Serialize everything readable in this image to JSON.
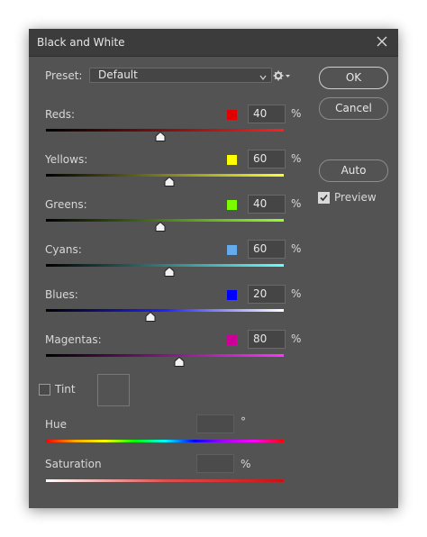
{
  "dialog": {
    "title": "Black and White"
  },
  "preset": {
    "label": "Preset:",
    "value": "Default"
  },
  "buttons": {
    "ok": "OK",
    "cancel": "Cancel",
    "auto": "Auto"
  },
  "preview": {
    "label": "Preview",
    "checked": true
  },
  "sliders": [
    {
      "label": "Reds:",
      "value": "40",
      "pos": 0.48,
      "color": "#e00000",
      "grad": "linear-gradient(to right,#000000,#ff2020)"
    },
    {
      "label": "Yellows:",
      "value": "60",
      "pos": 0.52,
      "color": "#ffff00",
      "grad": "linear-gradient(to right,#000000,#ffff33)"
    },
    {
      "label": "Greens:",
      "value": "40",
      "pos": 0.48,
      "color": "#7cfc00",
      "grad": "linear-gradient(to right,#000000,#99ff33)"
    },
    {
      "label": "Cyans:",
      "value": "60",
      "pos": 0.52,
      "color": "#66aaee",
      "grad": "linear-gradient(to right,#000000,#66ffff)"
    },
    {
      "label": "Blues:",
      "value": "20",
      "pos": 0.44,
      "color": "#0000ff",
      "grad": "linear-gradient(to right,#000000,#2020ff,#ffffff)"
    },
    {
      "label": "Magentas:",
      "value": "80",
      "pos": 0.56,
      "color": "#cc0099",
      "grad": "linear-gradient(to right,#000000,#ff33ff)"
    }
  ],
  "percent_sign": "%",
  "tint": {
    "label": "Tint",
    "checked": false
  },
  "hue": {
    "label": "Hue",
    "unit": "°"
  },
  "saturation": {
    "label": "Saturation",
    "unit": "%"
  },
  "colors": {
    "hue_grad": "linear-gradient(to right,#ff0000,#ffaa00,#ffff00,#00ff00,#00ffff,#0000ff,#aa00ff,#ff00ff,#ff0000)",
    "sat_grad": "linear-gradient(to right,#ffffff,#e05050,#cc1111)"
  }
}
